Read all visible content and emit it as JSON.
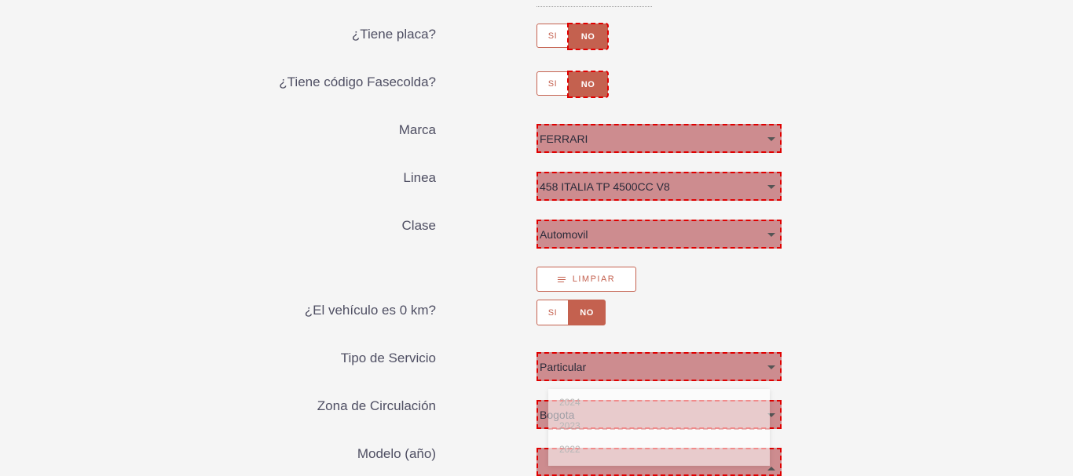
{
  "form": {
    "placa": {
      "label": "¿Tiene placa?",
      "si": "SI",
      "no": "NO",
      "selected": "NO"
    },
    "fasecolda": {
      "label": "¿Tiene código Fasecolda?",
      "si": "SI",
      "no": "NO",
      "selected": "NO"
    },
    "marca": {
      "label": "Marca",
      "value": "FERRARI"
    },
    "linea": {
      "label": "Linea",
      "value": "458 ITALIA TP 4500CC V8"
    },
    "clase": {
      "label": "Clase",
      "value": "Automovil"
    },
    "limpiar": {
      "label": "LIMPIAR"
    },
    "cero_km": {
      "label": "¿El vehículo es 0 km?",
      "si": "SI",
      "no": "NO",
      "selected": "NO"
    },
    "tipo_servicio": {
      "label": "Tipo de Servicio",
      "value": "Particular"
    },
    "zona": {
      "label": "Zona de Circulación",
      "value": "Bogota"
    },
    "modelo": {
      "label": "Modelo (año)",
      "value": "",
      "options": [
        "2024",
        "2023",
        "2022"
      ]
    }
  },
  "colors": {
    "accent": "#c4614f",
    "highlight": "#e00000",
    "field": "#cd8c8f"
  },
  "icons": {
    "limpiar": "clear-lines-icon",
    "select": "caret-down-icon"
  }
}
